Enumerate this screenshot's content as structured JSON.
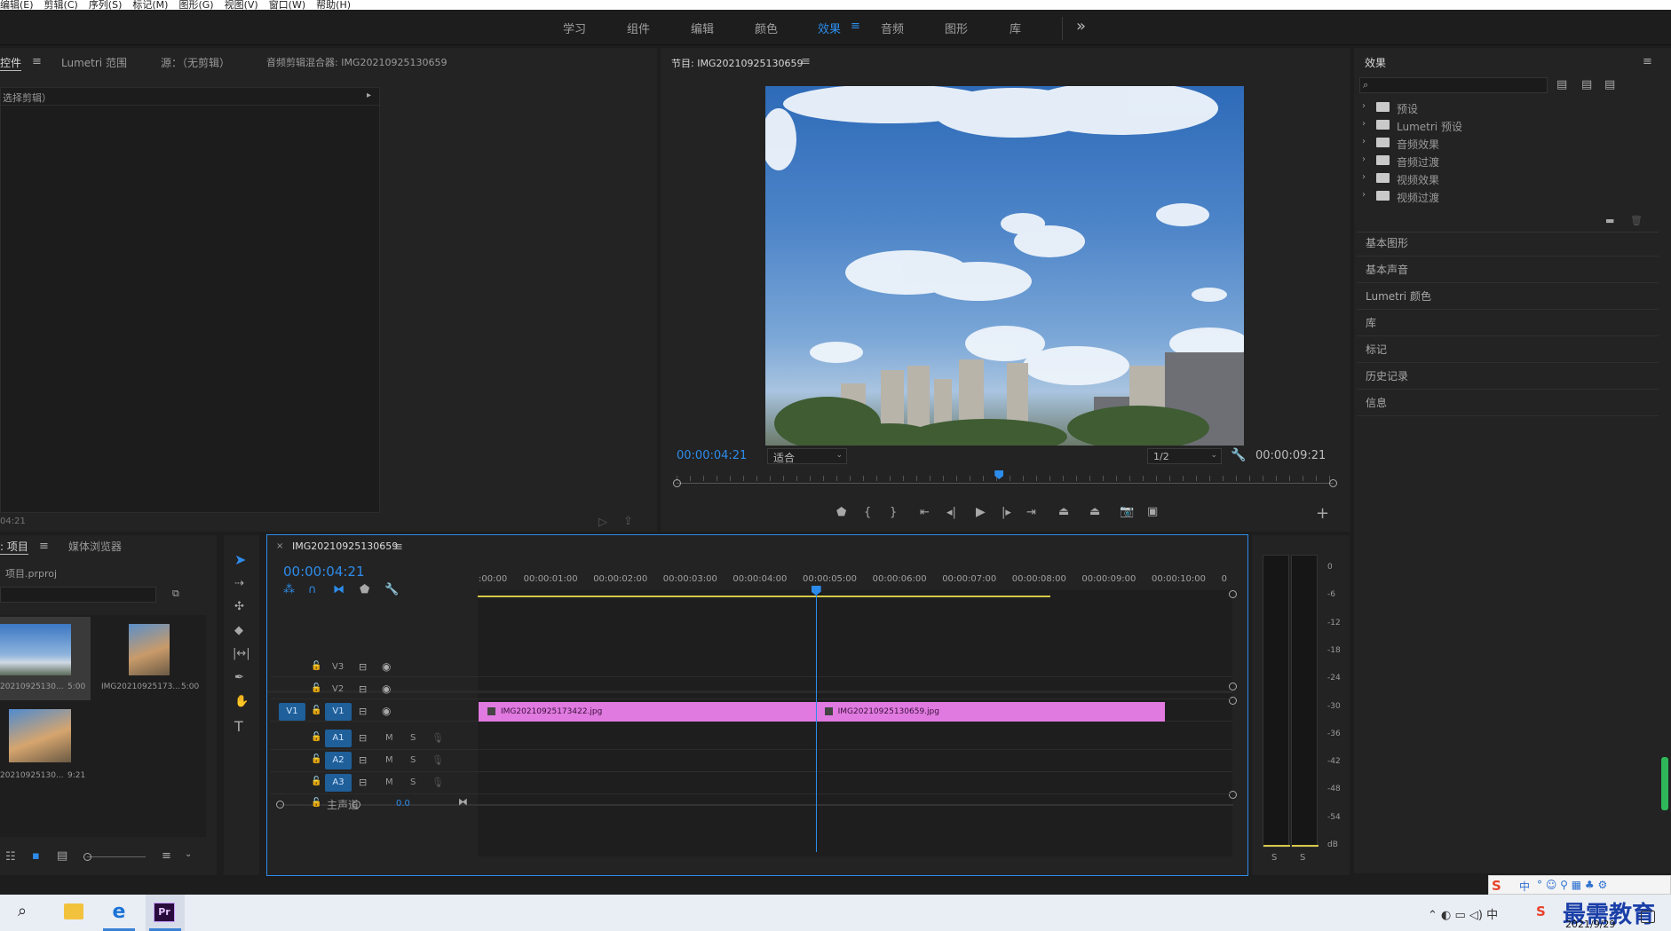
{
  "menubar": [
    "编辑(E)",
    "剪辑(C)",
    "序列(S)",
    "标记(M)",
    "图形(G)",
    "视图(V)",
    "窗口(W)",
    "帮助(H)"
  ],
  "workspaces": [
    "学习",
    "组件",
    "编辑",
    "颜色",
    "效果",
    "音频",
    "图形",
    "库"
  ],
  "workspace_active": "效果",
  "overflow_label": "»",
  "source_panel": {
    "tabs": [
      "控件",
      "Lumetri 范围",
      "源：（无剪辑）",
      "音频剪辑混合器: IMG20210925130659"
    ],
    "placeholder": "选择剪辑）",
    "timecode": "04:21"
  },
  "program_monitor": {
    "title": "节目: IMG20210925130659",
    "timecode_current": "00:00:04:21",
    "fit_label": "适合",
    "resolution": "1/2",
    "timecode_total": "00:00:09:21"
  },
  "effects_panel": {
    "title": "效果",
    "search_placeholder": "",
    "tree": [
      "预设",
      "Lumetri 预设",
      "音频效果",
      "音频过渡",
      "视频效果",
      "视频过渡"
    ],
    "categories": [
      "基本图形",
      "基本声音",
      "Lumetri 颜色",
      "库",
      "标记",
      "历史记录",
      "信息"
    ]
  },
  "project_panel": {
    "tabs": [
      "项目",
      "媒体浏览器"
    ],
    "project_name": "项目.prproj",
    "items": [
      {
        "name": "20210925130...",
        "duration": "5:00"
      },
      {
        "name": "IMG20210925173...",
        "duration": "5:00"
      },
      {
        "name": "20210925130...",
        "duration": "9:21"
      }
    ]
  },
  "timeline": {
    "sequence_name": "IMG20210925130659",
    "close_label": "×",
    "timecode": "00:00:04:21",
    "ruler": [
      ":00:00",
      "00:00:01:00",
      "00:00:02:00",
      "00:00:03:00",
      "00:00:04:00",
      "00:00:05:00",
      "00:00:06:00",
      "00:00:07:00",
      "00:00:08:00",
      "00:00:09:00",
      "00:00:10:00",
      "0"
    ],
    "video_tracks": [
      "V3",
      "V2",
      "V1"
    ],
    "audio_tracks": [
      "A1",
      "A2",
      "A3"
    ],
    "source_patch": "V1",
    "mute_label": "M",
    "solo_label": "S",
    "master_label": "主声道",
    "master_value": "0.0",
    "clips": [
      {
        "name": "IMG20210925173422.jpg",
        "start": 0,
        "end": 4.83
      },
      {
        "name": "IMG20210925130659.jpg",
        "start": 4.83,
        "end": 9.83
      }
    ],
    "playhead": 4.83
  },
  "audio_meter": {
    "labels": [
      "0",
      "-6",
      "-12",
      "-18",
      "-24",
      "-30",
      "-36",
      "-42",
      "-48",
      "-54",
      "dB"
    ],
    "solo_buttons": [
      "S",
      "S"
    ]
  },
  "taskbar": {
    "date": "2021/9/29",
    "ime_label": "中",
    "watermark": "最需教育",
    "premiere_label": "Pr"
  },
  "colors": {
    "accent": "#2d8ceb",
    "clip": "#e07ae0",
    "bg": "#1d1d1d",
    "panel": "#232323"
  }
}
